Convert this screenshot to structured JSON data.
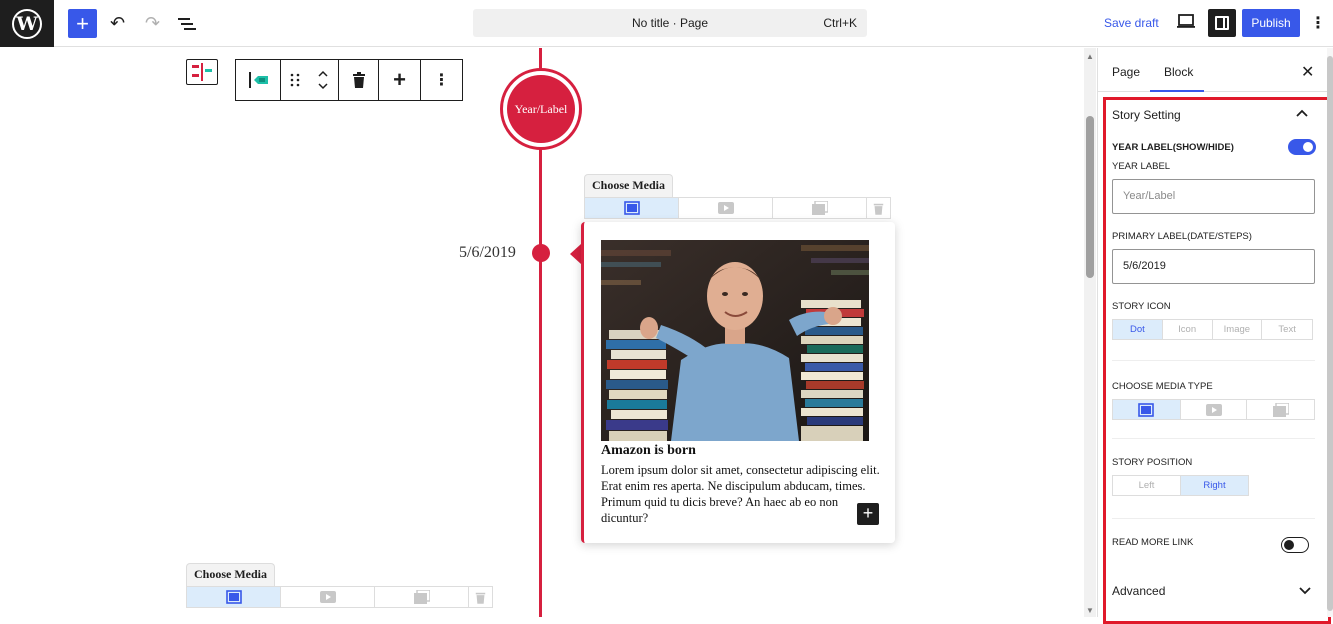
{
  "topbar": {
    "logo": "W",
    "add_icon": "+",
    "undo_icon": "↶",
    "redo_icon": "↷",
    "document_title": "No title · Page",
    "shortcut": "Ctrl+K",
    "save_draft": "Save draft",
    "publish": "Publish",
    "more_icon": "⋮"
  },
  "canvas": {
    "year_label": "Year/Label",
    "media_picker_title": "Choose Media",
    "story": {
      "date": "5/6/2019",
      "title": "Amazon is born",
      "text": "Lorem ipsum dolor sit amet, consectetur adipiscing elit. Erat enim res aperta. Ne discipulum abducam, times. Primum quid tu dicis breve? An haec ab eo non dicuntur?",
      "add_icon": "+"
    },
    "toolbar": {
      "more_icon": "⋮",
      "add_icon": "+"
    }
  },
  "sidebar": {
    "tabs": [
      "Page",
      "Block"
    ],
    "close_icon": "✕",
    "panel_title": "Story Setting",
    "year_label_toggle": "YEAR LABEL(SHOW/HIDE)",
    "year_label_toggle_on": true,
    "year_label": "YEAR LABEL",
    "year_label_placeholder": "Year/Label",
    "primary_label": "PRIMARY LABEL(DATE/STEPS)",
    "primary_label_value": "5/6/2019",
    "story_icon": "STORY ICON",
    "story_icon_options": [
      "Dot",
      "Icon",
      "Image",
      "Text"
    ],
    "story_icon_selected": "Dot",
    "media_type": "CHOOSE MEDIA TYPE",
    "media_type_selected": "image",
    "story_position": "STORY POSITION",
    "story_position_options": [
      "Left",
      "Right"
    ],
    "story_position_selected": "Right",
    "read_more": "READ MORE LINK",
    "read_more_on": false,
    "advanced": "Advanced"
  }
}
